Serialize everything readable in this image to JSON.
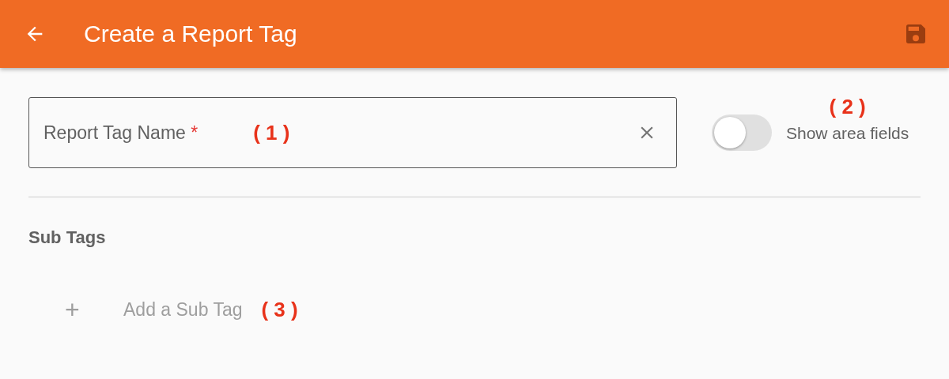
{
  "app_bar": {
    "title": "Create a Report Tag"
  },
  "name_field": {
    "label": "Report Tag Name",
    "required_mark": "*",
    "annotation": "( 1 )"
  },
  "area_toggle": {
    "label": "Show area fields",
    "on": false,
    "annotation": "( 2 )"
  },
  "sub_tags": {
    "heading": "Sub Tags",
    "add_label": "Add a Sub Tag",
    "add_icon": "+",
    "annotation": "( 3 )"
  }
}
